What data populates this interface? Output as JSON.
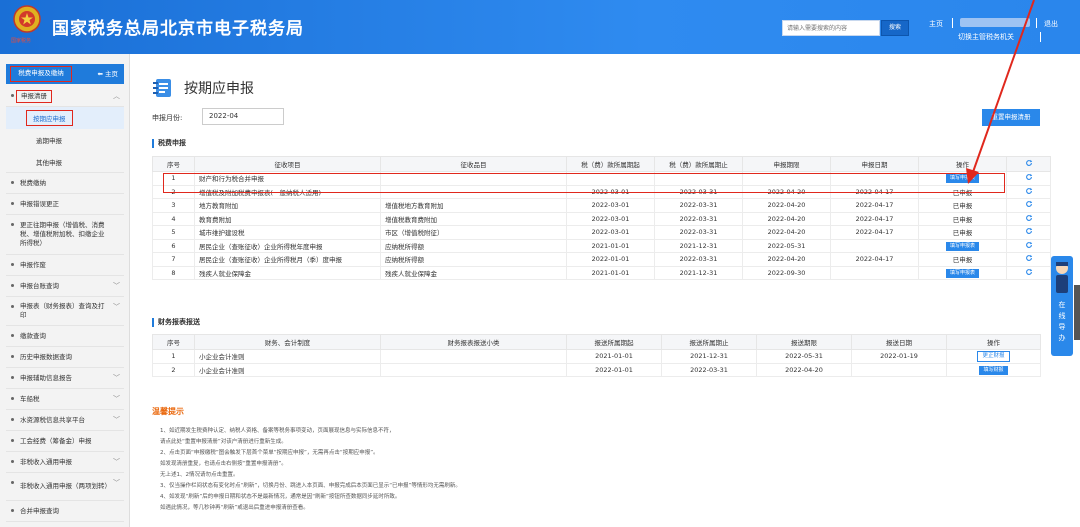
{
  "header": {
    "site_title": "国家税务总局北京市电子税务局",
    "emblem_caption": "国家税务",
    "search_placeholder": "请输入需要搜索的内容",
    "search_button": "搜索",
    "home_link": "主页",
    "logout_link": "退出",
    "switch_org": "切换主管税务机关"
  },
  "sidebar": {
    "head_title": "税费申报及缴纳",
    "home": "主页",
    "items": [
      {
        "label": "申报清册",
        "expanded": true,
        "subs": [
          "按期应申报",
          "逾期申报",
          "其他申报"
        ]
      },
      {
        "label": "税费缴纳"
      },
      {
        "label": "申报错误更正"
      },
      {
        "label": "更正往期申报（增值税、消费税、增值税附加税、扣缴企业所得税）"
      },
      {
        "label": "申报作废"
      },
      {
        "label": "申报台账查询"
      },
      {
        "label": "申报表（财务报表）查询及打印"
      },
      {
        "label": "缴款查询"
      },
      {
        "label": "历史申报数据查询"
      },
      {
        "label": "申报辅助信息报告"
      },
      {
        "label": "车船税"
      },
      {
        "label": "水资源税信息共享平台"
      },
      {
        "label": "工会经费（筹备金）申报"
      },
      {
        "label": "非税收入通用申报"
      },
      {
        "label": "非税收入通用申报（两项划转）"
      },
      {
        "label": "合并申报查询"
      }
    ]
  },
  "main": {
    "title": "按期应申报",
    "period_label": "申报月份:",
    "period_value": "2022-04",
    "reset_button": "重置申报清册",
    "tax_section": {
      "title": "税费申报",
      "headers": [
        "序号",
        "征收项目",
        "征收品目",
        "税（费）款所属期起",
        "税（费）款所属期止",
        "申报期限",
        "申报日期",
        "操作"
      ],
      "rows": [
        {
          "no": "1",
          "item": "财产和行为税合并申报",
          "sub": "",
          "start": "",
          "end": "",
          "deadline": "",
          "date": "",
          "op": "填写申报表",
          "op_type": "button"
        },
        {
          "no": "2",
          "item": "增值税及附加税费申报表(一般纳税人适用)",
          "sub": "",
          "start": "2022-03-01",
          "end": "2022-03-31",
          "deadline": "2022-04-20",
          "date": "2022-04-17",
          "op": "已申报",
          "op_type": "text"
        },
        {
          "no": "3",
          "item": "地方教育附加",
          "sub": "增值税地方教育附加",
          "start": "2022-03-01",
          "end": "2022-03-31",
          "deadline": "2022-04-20",
          "date": "2022-04-17",
          "op": "已申报",
          "op_type": "text"
        },
        {
          "no": "4",
          "item": "教育费附加",
          "sub": "增值税教育费附加",
          "start": "2022-03-01",
          "end": "2022-03-31",
          "deadline": "2022-04-20",
          "date": "2022-04-17",
          "op": "已申报",
          "op_type": "text"
        },
        {
          "no": "5",
          "item": "城市维护建设税",
          "sub": "市区（增值税附征）",
          "start": "2022-03-01",
          "end": "2022-03-31",
          "deadline": "2022-04-20",
          "date": "2022-04-17",
          "op": "已申报",
          "op_type": "text"
        },
        {
          "no": "6",
          "item": "居民企业（查账征收）企业所得税年度申报",
          "sub": "应纳税所得额",
          "start": "2021-01-01",
          "end": "2021-12-31",
          "deadline": "2022-05-31",
          "date": "",
          "op": "填写申报表",
          "op_type": "button"
        },
        {
          "no": "7",
          "item": "居民企业（查账征收）企业所得税月（季）度申报",
          "sub": "应纳税所得额",
          "start": "2022-01-01",
          "end": "2022-03-31",
          "deadline": "2022-04-20",
          "date": "2022-04-17",
          "op": "已申报",
          "op_type": "text"
        },
        {
          "no": "8",
          "item": "残疾人就业保障金",
          "sub": "残疾人就业保障金",
          "start": "2021-01-01",
          "end": "2021-12-31",
          "deadline": "2022-09-30",
          "date": "",
          "op": "填写申报表",
          "op_type": "button"
        }
      ]
    },
    "fin_section": {
      "title": "财务报表报送",
      "headers": [
        "序号",
        "财务、会计制度",
        "财务报表报送小类",
        "报送所属期起",
        "报送所属期止",
        "报送期限",
        "报送日期",
        "操作"
      ],
      "rows": [
        {
          "no": "1",
          "system": "小企业会计准则",
          "sub": "",
          "start": "2021-01-01",
          "end": "2021-12-31",
          "deadline": "2022-05-31",
          "date": "2022-01-19",
          "op": "更正财报",
          "op_type": "outline"
        },
        {
          "no": "2",
          "system": "小企业会计准则",
          "sub": "",
          "start": "2022-01-01",
          "end": "2022-03-31",
          "deadline": "2022-04-20",
          "date": "",
          "op": "填写财报",
          "op_type": "button"
        }
      ]
    },
    "tips": {
      "title": "温馨提示",
      "lines": [
        "1、如近期发生税费种认定、纳税人资格、备案等税务事项变动，页面展现信息与实际信息不符，",
        "请点此处“重置申报清册”对该户清册进行重新生成。",
        "2、点击页面“申报缴税”图会触发下层首个菜单“按期应申报”，无需再点击“按期应申报”。",
        "如发现清册重复，也请点击右侧按“重置申报清册”。",
        "无上述1、2情况请勿点击重置。",
        "3、仅当操作栏间状态有变化时点“刷新”，切换月份、跳进入本页面、申报完成后本页面已显示“已申报”等情形均无需刷新。",
        "4、如发现“刷新”后的申报日期和状态不是最新情况，通常是因“刷新”按钮所查数据同步延时所致。",
        "如遇此情况，等几秒钟再“刷新”或退出后重进申报清册查看。"
      ]
    }
  },
  "float_tool": {
    "label": "在线导办"
  },
  "colors": {
    "topbar": "#2f8bf0",
    "accent": "#2a88ea",
    "highlight": "#e0281d",
    "tip_title": "#ea6a10"
  }
}
